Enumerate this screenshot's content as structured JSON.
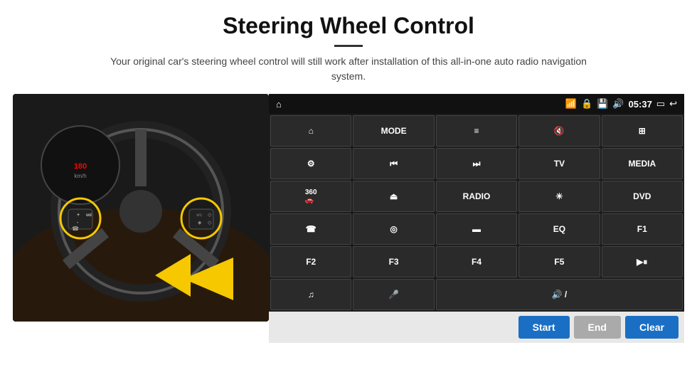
{
  "page": {
    "title": "Steering Wheel Control",
    "subtitle": "Your original car's steering wheel control will still work after installation of this all-in-one auto radio navigation system.",
    "divider": ""
  },
  "status_bar": {
    "time": "05:37",
    "icons": [
      "home",
      "wifi",
      "lock",
      "sd",
      "bt",
      "screen",
      "back"
    ]
  },
  "grid": {
    "rows": [
      [
        {
          "label": "▲",
          "type": "icon",
          "name": "home"
        },
        {
          "label": "MODE",
          "type": "text",
          "name": "mode"
        },
        {
          "label": "≡",
          "type": "icon",
          "name": "menu"
        },
        {
          "label": "🔇",
          "type": "icon",
          "name": "mute"
        },
        {
          "label": "⊞",
          "type": "icon",
          "name": "apps"
        }
      ],
      [
        {
          "label": "⚙",
          "type": "icon",
          "name": "settings"
        },
        {
          "label": "⏮",
          "type": "icon",
          "name": "prev"
        },
        {
          "label": "⏭",
          "type": "icon",
          "name": "next"
        },
        {
          "label": "TV",
          "type": "text",
          "name": "tv"
        },
        {
          "label": "MEDIA",
          "type": "text",
          "name": "media"
        }
      ],
      [
        {
          "label": "360",
          "type": "text-sub",
          "name": "360cam"
        },
        {
          "label": "⏏",
          "type": "icon",
          "name": "eject"
        },
        {
          "label": "RADIO",
          "type": "text",
          "name": "radio"
        },
        {
          "label": "☀",
          "type": "icon",
          "name": "brightness"
        },
        {
          "label": "DVD",
          "type": "text",
          "name": "dvd"
        }
      ],
      [
        {
          "label": "☎",
          "type": "icon",
          "name": "phone"
        },
        {
          "label": "🌐",
          "type": "icon",
          "name": "nav"
        },
        {
          "label": "▬",
          "type": "icon",
          "name": "display"
        },
        {
          "label": "EQ",
          "type": "text",
          "name": "eq"
        },
        {
          "label": "F1",
          "type": "text",
          "name": "f1"
        }
      ],
      [
        {
          "label": "F2",
          "type": "text",
          "name": "f2"
        },
        {
          "label": "F3",
          "type": "text",
          "name": "f3"
        },
        {
          "label": "F4",
          "type": "text",
          "name": "f4"
        },
        {
          "label": "F5",
          "type": "text",
          "name": "f5"
        },
        {
          "label": "▶⏸",
          "type": "icon",
          "name": "playpause"
        }
      ],
      [
        {
          "label": "♫",
          "type": "icon",
          "name": "music"
        },
        {
          "label": "🎤",
          "type": "icon",
          "name": "mic"
        },
        {
          "label": "🔊",
          "type": "icon",
          "name": "volume",
          "wide": true
        },
        {
          "label": "",
          "type": "empty",
          "name": "empty1"
        },
        {
          "label": "",
          "type": "empty",
          "name": "empty2"
        }
      ]
    ],
    "bottom_buttons": [
      {
        "label": "Start",
        "name": "start",
        "style": "start"
      },
      {
        "label": "End",
        "name": "end",
        "style": "end"
      },
      {
        "label": "Clear",
        "name": "clear",
        "style": "clear"
      }
    ]
  }
}
